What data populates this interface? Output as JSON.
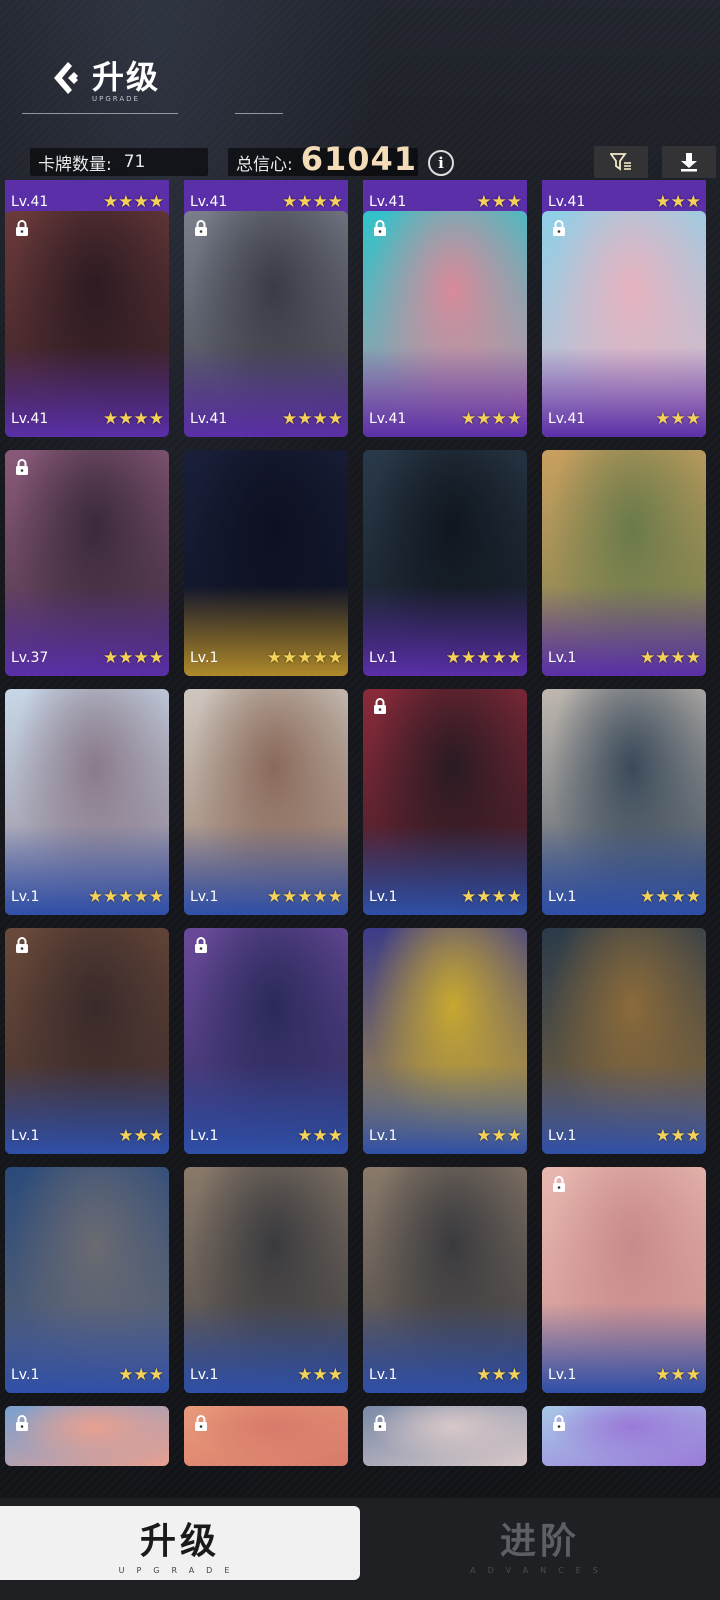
{
  "header": {
    "title": "升级",
    "subtitle": "UPGRADE",
    "card_count_label": "卡牌数量:",
    "card_count_value": "71",
    "trust_label": "总信心:",
    "trust_value": "61041",
    "info_symbol": "i"
  },
  "top_row": [
    {
      "level": "Lv.41",
      "stars": "★★★★"
    },
    {
      "level": "Lv.41",
      "stars": "★★★★"
    },
    {
      "level": "Lv.41",
      "stars": "★★★"
    },
    {
      "level": "Lv.41",
      "stars": "★★★"
    }
  ],
  "cards": [
    {
      "level": "Lv.41",
      "stars": "★★★★",
      "locked": true,
      "colors": [
        "#6b3a3a",
        "#2c1b22",
        "#5a2fa8"
      ]
    },
    {
      "level": "Lv.41",
      "stars": "★★★★",
      "locked": true,
      "colors": [
        "#7a7f8c",
        "#3a3b44",
        "#5a2fa8"
      ]
    },
    {
      "level": "Lv.41",
      "stars": "★★★★",
      "locked": true,
      "colors": [
        "#2fc3c9",
        "#d98a9a",
        "#5a2fa8"
      ]
    },
    {
      "level": "Lv.41",
      "stars": "★★★",
      "locked": true,
      "colors": [
        "#8ed0e8",
        "#e8b3c0",
        "#5a2fa8"
      ]
    },
    {
      "level": "Lv.37",
      "stars": "★★★★",
      "locked": true,
      "colors": [
        "#8a5a7a",
        "#3a2a3a",
        "#5a2fa8"
      ]
    },
    {
      "level": "Lv.1",
      "stars": "★★★★★",
      "locked": false,
      "colors": [
        "#1a1f3a",
        "#0d1020",
        "#b08a2a"
      ]
    },
    {
      "level": "Lv.1",
      "stars": "★★★★★",
      "locked": false,
      "colors": [
        "#2a3a4a",
        "#10161e",
        "#5a2fa8"
      ]
    },
    {
      "level": "Lv.1",
      "stars": "★★★★",
      "locked": false,
      "colors": [
        "#c9a060",
        "#6a7a4a",
        "#5a2fa8"
      ]
    },
    {
      "level": "Lv.1",
      "stars": "★★★★★",
      "locked": false,
      "colors": [
        "#c8d8e8",
        "#8a7a8a",
        "#2f4fa8"
      ]
    },
    {
      "level": "Lv.1",
      "stars": "★★★★★",
      "locked": false,
      "colors": [
        "#cfc8c0",
        "#8a6a5a",
        "#2f4fa8"
      ]
    },
    {
      "level": "Lv.1",
      "stars": "★★★★",
      "locked": true,
      "colors": [
        "#8a2a3a",
        "#2a1a22",
        "#2f4fa8"
      ]
    },
    {
      "level": "Lv.1",
      "stars": "★★★★",
      "locked": false,
      "colors": [
        "#c0b8b0",
        "#3a4a5a",
        "#2f4fa8"
      ]
    },
    {
      "level": "Lv.1",
      "stars": "★★★",
      "locked": true,
      "colors": [
        "#6a4a3a",
        "#3a2a2a",
        "#2f4fa8"
      ]
    },
    {
      "level": "Lv.1",
      "stars": "★★★",
      "locked": true,
      "colors": [
        "#6a4a9a",
        "#2a2a5a",
        "#2f4fa8"
      ]
    },
    {
      "level": "Lv.1",
      "stars": "★★★",
      "locked": false,
      "colors": [
        "#3a3a8a",
        "#c8a830",
        "#2f4fa8"
      ]
    },
    {
      "level": "Lv.1",
      "stars": "★★★",
      "locked": false,
      "colors": [
        "#2a3a4a",
        "#8a6a3a",
        "#2f4fa8"
      ]
    },
    {
      "level": "Lv.1",
      "stars": "★★★",
      "locked": false,
      "colors": [
        "#2a4a7a",
        "#6a6a72",
        "#2f4fa8"
      ]
    },
    {
      "level": "Lv.1",
      "stars": "★★★",
      "locked": false,
      "colors": [
        "#8a7a6a",
        "#3a3a3e",
        "#2f4fa8"
      ]
    },
    {
      "level": "Lv.1",
      "stars": "★★★",
      "locked": false,
      "colors": [
        "#8a7a6a",
        "#3a3a3e",
        "#2f4fa8"
      ]
    },
    {
      "level": "Lv.1",
      "stars": "★★★",
      "locked": true,
      "colors": [
        "#e8b8b0",
        "#c88a8a",
        "#2f4fa8"
      ]
    }
  ],
  "partial_row": [
    {
      "locked": true,
      "colors": [
        "#7aa0d0",
        "#e8a090"
      ]
    },
    {
      "locked": true,
      "colors": [
        "#e89a7a",
        "#d87a6a"
      ]
    },
    {
      "locked": true,
      "colors": [
        "#7a8aa8",
        "#d8c8c8"
      ]
    },
    {
      "locked": true,
      "colors": [
        "#a8c8e8",
        "#9a7ad8"
      ]
    }
  ],
  "tabs": {
    "upgrade_label": "升级",
    "upgrade_sub": "UPGRADE",
    "advance_label": "进阶",
    "advance_sub": "ADVANCES"
  },
  "colors": {
    "trust_value": "#f4dcb8",
    "star": "#f4d25a",
    "purple_frame": "#5a2fa8",
    "blue_frame": "#2f4fa8",
    "gold_frame": "#b08a2a"
  }
}
